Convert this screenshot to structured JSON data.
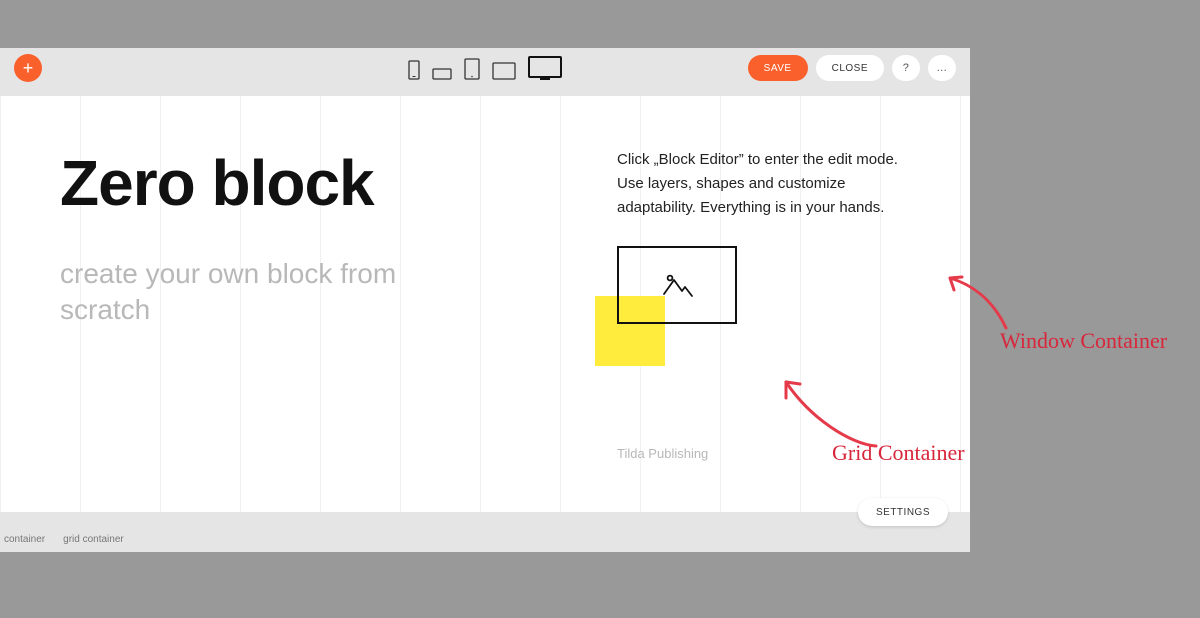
{
  "toolbar": {
    "save_label": "SAVE",
    "close_label": "CLOSE"
  },
  "content": {
    "heading": "Zero block",
    "subtitle": "create your own block from scratch",
    "description": "Click „Block Editor” to enter the edit mode. Use layers, shapes and customize adaptability. Everything is in your hands.",
    "credit": "Tilda Publishing"
  },
  "settings_label": "SETTINGS",
  "footer": {
    "tab1": "container",
    "tab2": "grid container"
  },
  "annotations": {
    "window": "Window Container",
    "grid": "Grid Container"
  }
}
